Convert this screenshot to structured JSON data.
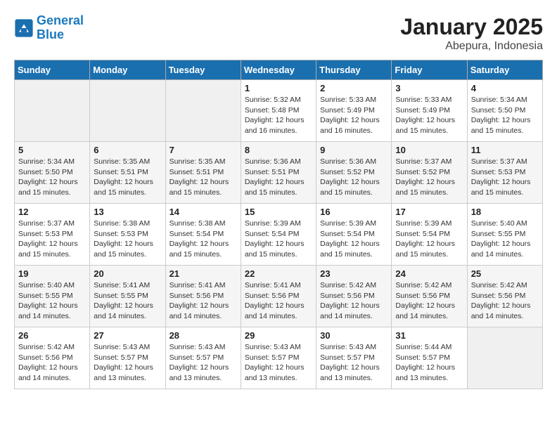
{
  "logo": {
    "line1": "General",
    "line2": "Blue"
  },
  "calendar": {
    "title": "January 2025",
    "subtitle": "Abepura, Indonesia"
  },
  "headers": [
    "Sunday",
    "Monday",
    "Tuesday",
    "Wednesday",
    "Thursday",
    "Friday",
    "Saturday"
  ],
  "weeks": [
    [
      {
        "day": "",
        "info": ""
      },
      {
        "day": "",
        "info": ""
      },
      {
        "day": "",
        "info": ""
      },
      {
        "day": "1",
        "info": "Sunrise: 5:32 AM\nSunset: 5:48 PM\nDaylight: 12 hours\nand 16 minutes."
      },
      {
        "day": "2",
        "info": "Sunrise: 5:33 AM\nSunset: 5:49 PM\nDaylight: 12 hours\nand 16 minutes."
      },
      {
        "day": "3",
        "info": "Sunrise: 5:33 AM\nSunset: 5:49 PM\nDaylight: 12 hours\nand 15 minutes."
      },
      {
        "day": "4",
        "info": "Sunrise: 5:34 AM\nSunset: 5:50 PM\nDaylight: 12 hours\nand 15 minutes."
      }
    ],
    [
      {
        "day": "5",
        "info": "Sunrise: 5:34 AM\nSunset: 5:50 PM\nDaylight: 12 hours\nand 15 minutes."
      },
      {
        "day": "6",
        "info": "Sunrise: 5:35 AM\nSunset: 5:51 PM\nDaylight: 12 hours\nand 15 minutes."
      },
      {
        "day": "7",
        "info": "Sunrise: 5:35 AM\nSunset: 5:51 PM\nDaylight: 12 hours\nand 15 minutes."
      },
      {
        "day": "8",
        "info": "Sunrise: 5:36 AM\nSunset: 5:51 PM\nDaylight: 12 hours\nand 15 minutes."
      },
      {
        "day": "9",
        "info": "Sunrise: 5:36 AM\nSunset: 5:52 PM\nDaylight: 12 hours\nand 15 minutes."
      },
      {
        "day": "10",
        "info": "Sunrise: 5:37 AM\nSunset: 5:52 PM\nDaylight: 12 hours\nand 15 minutes."
      },
      {
        "day": "11",
        "info": "Sunrise: 5:37 AM\nSunset: 5:53 PM\nDaylight: 12 hours\nand 15 minutes."
      }
    ],
    [
      {
        "day": "12",
        "info": "Sunrise: 5:37 AM\nSunset: 5:53 PM\nDaylight: 12 hours\nand 15 minutes."
      },
      {
        "day": "13",
        "info": "Sunrise: 5:38 AM\nSunset: 5:53 PM\nDaylight: 12 hours\nand 15 minutes."
      },
      {
        "day": "14",
        "info": "Sunrise: 5:38 AM\nSunset: 5:54 PM\nDaylight: 12 hours\nand 15 minutes."
      },
      {
        "day": "15",
        "info": "Sunrise: 5:39 AM\nSunset: 5:54 PM\nDaylight: 12 hours\nand 15 minutes."
      },
      {
        "day": "16",
        "info": "Sunrise: 5:39 AM\nSunset: 5:54 PM\nDaylight: 12 hours\nand 15 minutes."
      },
      {
        "day": "17",
        "info": "Sunrise: 5:39 AM\nSunset: 5:54 PM\nDaylight: 12 hours\nand 15 minutes."
      },
      {
        "day": "18",
        "info": "Sunrise: 5:40 AM\nSunset: 5:55 PM\nDaylight: 12 hours\nand 14 minutes."
      }
    ],
    [
      {
        "day": "19",
        "info": "Sunrise: 5:40 AM\nSunset: 5:55 PM\nDaylight: 12 hours\nand 14 minutes."
      },
      {
        "day": "20",
        "info": "Sunrise: 5:41 AM\nSunset: 5:55 PM\nDaylight: 12 hours\nand 14 minutes."
      },
      {
        "day": "21",
        "info": "Sunrise: 5:41 AM\nSunset: 5:56 PM\nDaylight: 12 hours\nand 14 minutes."
      },
      {
        "day": "22",
        "info": "Sunrise: 5:41 AM\nSunset: 5:56 PM\nDaylight: 12 hours\nand 14 minutes."
      },
      {
        "day": "23",
        "info": "Sunrise: 5:42 AM\nSunset: 5:56 PM\nDaylight: 12 hours\nand 14 minutes."
      },
      {
        "day": "24",
        "info": "Sunrise: 5:42 AM\nSunset: 5:56 PM\nDaylight: 12 hours\nand 14 minutes."
      },
      {
        "day": "25",
        "info": "Sunrise: 5:42 AM\nSunset: 5:56 PM\nDaylight: 12 hours\nand 14 minutes."
      }
    ],
    [
      {
        "day": "26",
        "info": "Sunrise: 5:42 AM\nSunset: 5:56 PM\nDaylight: 12 hours\nand 14 minutes."
      },
      {
        "day": "27",
        "info": "Sunrise: 5:43 AM\nSunset: 5:57 PM\nDaylight: 12 hours\nand 13 minutes."
      },
      {
        "day": "28",
        "info": "Sunrise: 5:43 AM\nSunset: 5:57 PM\nDaylight: 12 hours\nand 13 minutes."
      },
      {
        "day": "29",
        "info": "Sunrise: 5:43 AM\nSunset: 5:57 PM\nDaylight: 12 hours\nand 13 minutes."
      },
      {
        "day": "30",
        "info": "Sunrise: 5:43 AM\nSunset: 5:57 PM\nDaylight: 12 hours\nand 13 minutes."
      },
      {
        "day": "31",
        "info": "Sunrise: 5:44 AM\nSunset: 5:57 PM\nDaylight: 12 hours\nand 13 minutes."
      },
      {
        "day": "",
        "info": ""
      }
    ]
  ]
}
